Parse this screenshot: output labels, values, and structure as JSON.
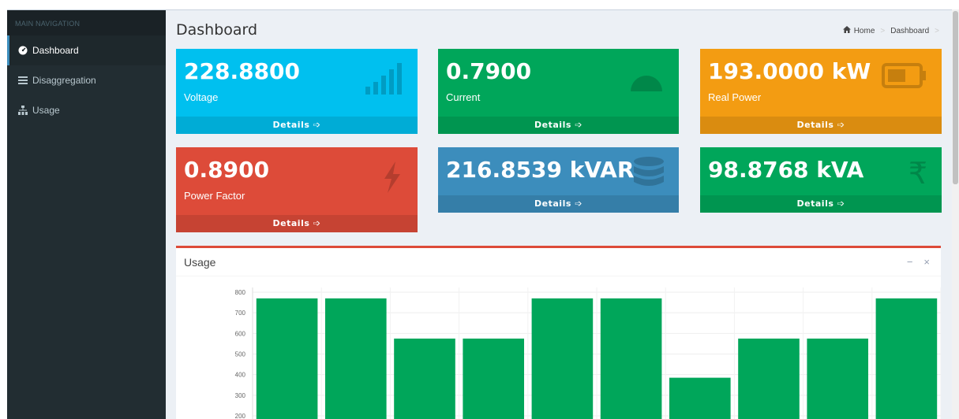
{
  "sidebar": {
    "header": "MAIN NAVIGATION",
    "items": [
      {
        "label": "Dashboard",
        "icon": "dashboard-icon",
        "active": true
      },
      {
        "label": "Disaggregation",
        "icon": "list-icon",
        "active": false
      },
      {
        "label": "Usage",
        "icon": "sitemap-icon",
        "active": false
      }
    ]
  },
  "page": {
    "title": "Dashboard",
    "breadcrumb": [
      "Home",
      "Dashboard"
    ]
  },
  "boxes": [
    {
      "value": "228.8800",
      "label": "Voltage",
      "footer": "Details",
      "color": "#00c0ef",
      "icon": "signal-icon"
    },
    {
      "value": "0.7900",
      "label": "Current",
      "footer": "Details",
      "color": "#00a65a",
      "icon": "gauge-icon"
    },
    {
      "value": "193.0000 kW",
      "label": "Real Power",
      "footer": "Details",
      "color": "#f39c12",
      "icon": "battery-icon"
    },
    {
      "value": "0.8900",
      "label": "Power Factor",
      "footer": "Details",
      "color": "#dd4b39",
      "icon": "bolt-icon"
    },
    {
      "value": "216.8539 kVAR",
      "label": "",
      "footer": "Details",
      "color": "#3c8dbc",
      "icon": "database-icon"
    },
    {
      "value": "98.8768 kVA",
      "label": "",
      "footer": "Details",
      "color": "#00a65a",
      "icon": "rupee-icon"
    }
  ],
  "usage": {
    "title": "Usage",
    "minimize": "−",
    "close": "×"
  },
  "chart_data": {
    "type": "bar",
    "title": "",
    "xlabel": "",
    "ylabel": "",
    "ylim": [
      200,
      800
    ],
    "yticks": [
      800,
      700,
      600,
      500,
      400,
      300,
      200
    ],
    "values": [
      770,
      770,
      575,
      575,
      770,
      770,
      385,
      575,
      575,
      770
    ],
    "bar_color": "#00a65a",
    "grid": true
  }
}
